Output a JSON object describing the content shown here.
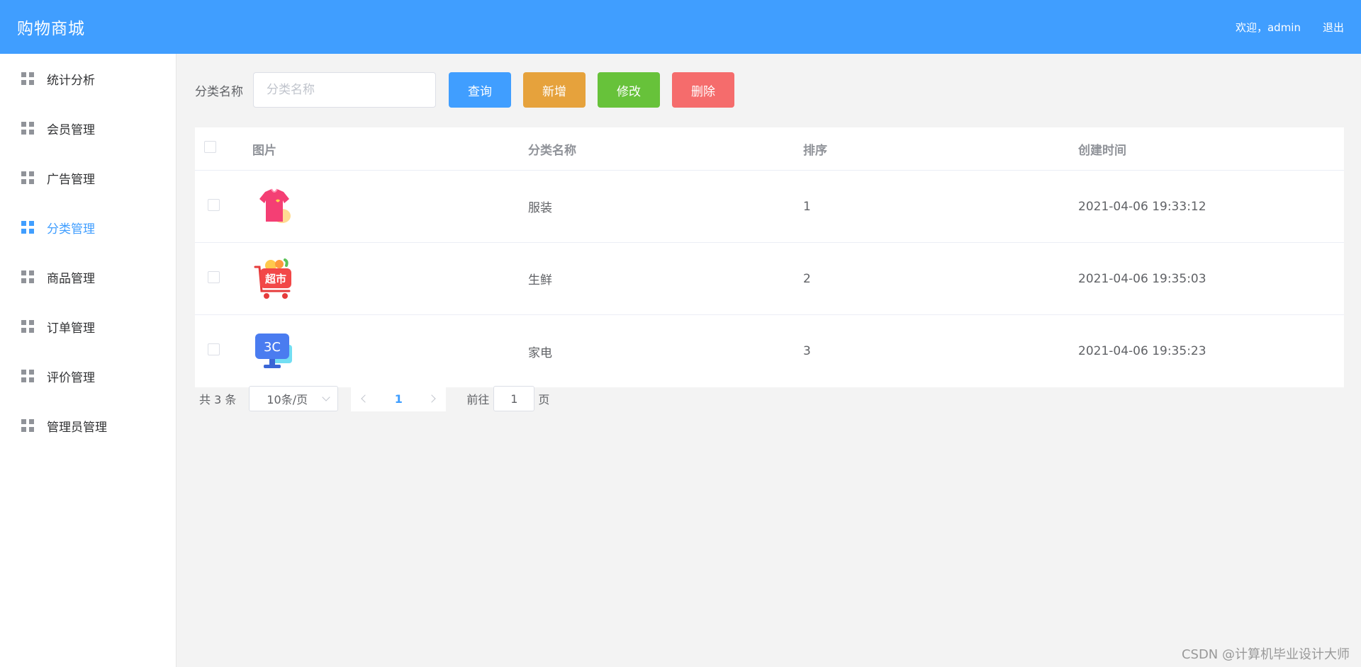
{
  "header": {
    "brand": "购物商城",
    "welcome": "欢迎，admin",
    "logout": "退出"
  },
  "sidebar": {
    "items": [
      {
        "label": "统计分析",
        "icon": "grid-icon",
        "active": false
      },
      {
        "label": "会员管理",
        "icon": "grid-icon",
        "active": false
      },
      {
        "label": "广告管理",
        "icon": "grid-icon",
        "active": false
      },
      {
        "label": "分类管理",
        "icon": "grid-icon",
        "active": true
      },
      {
        "label": "商品管理",
        "icon": "grid-icon",
        "active": false
      },
      {
        "label": "订单管理",
        "icon": "grid-icon",
        "active": false
      },
      {
        "label": "评价管理",
        "icon": "grid-icon",
        "active": false
      },
      {
        "label": "管理员管理",
        "icon": "grid-icon",
        "active": false
      }
    ]
  },
  "toolbar": {
    "label": "分类名称",
    "search_placeholder": "分类名称",
    "search_value": "",
    "query": "查询",
    "add": "新增",
    "edit": "修改",
    "delete": "删除"
  },
  "table": {
    "columns": [
      "图片",
      "分类名称",
      "排序",
      "创建时间"
    ],
    "rows": [
      {
        "image": "tshirt-icon",
        "name": "服装",
        "sort": "1",
        "created": "2021-04-06 19:33:12"
      },
      {
        "image": "supermarket-cart-icon",
        "name": "生鲜",
        "sort": "2",
        "created": "2021-04-06 19:35:03",
        "image_text": "超市"
      },
      {
        "image": "3c-monitor-icon",
        "name": "家电",
        "sort": "3",
        "created": "2021-04-06 19:35:23",
        "image_text": "3C"
      }
    ]
  },
  "pagination": {
    "total": "共 3 条",
    "page_size": "10条/页",
    "current": "1",
    "goto_label": "前往",
    "goto_value": "1",
    "goto_suffix": "页"
  },
  "watermark": "CSDN @计算机毕业设计大师",
  "colors": {
    "primary": "#409eff",
    "warning": "#e6a23c",
    "success": "#67c23a",
    "danger": "#f56c6c"
  }
}
